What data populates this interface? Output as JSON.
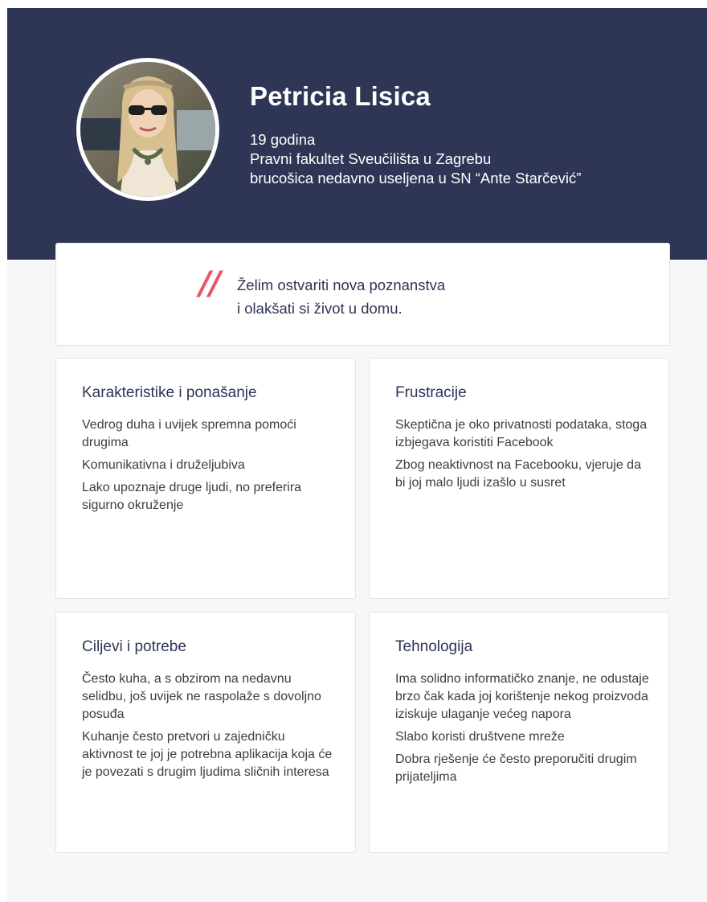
{
  "profile": {
    "name": "Petricia Lisica",
    "age": "19 godina",
    "faculty": "Pravni fakultet Sveučilišta u Zagrebu",
    "status": "brucošica nedavno useljena u SN “Ante Starčević”"
  },
  "quote": {
    "mark": "//",
    "line1": "Želim ostvariti nova poznanstva",
    "line2": "i olakšati si život u domu."
  },
  "cards": {
    "karakteristike": {
      "title": "Karakteristike i ponašanje",
      "items": [
        "Vedrog duha i uvijek spremna pomoći drugima",
        "Komunikativna i druželjubiva",
        "Lako upoznaje druge ljudi, no preferira sigurno okruženje"
      ]
    },
    "frustracije": {
      "title": "Frustracije",
      "items": [
        "Skeptična je oko privatnosti podataka, stoga izbjegava koristiti Facebook",
        "Zbog neaktivnost na Facebooku, vjeruje da bi joj malo ljudi izašlo u susret"
      ]
    },
    "ciljevi": {
      "title": "Ciljevi i potrebe",
      "items": [
        "Često kuha, a s obzirom na nedavnu selidbu, još uvijek ne raspolaže s dovoljno posuđa",
        "Kuhanje često pretvori u zajedničku aktivnost te joj je potrebna aplikacija koja će je povezati s drugim ljudima sličnih interesa"
      ]
    },
    "tehnologija": {
      "title": "Tehnologija",
      "items": [
        "Ima solidno informatičko znanje, ne odustaje brzo čak kada joj korištenje nekog proizvoda iziskuje ulaganje većeg napora",
        "Slabo koristi društvene mreže",
        "Dobra rješenje će često preporučiti drugim prijateljima"
      ]
    }
  },
  "colors": {
    "hero_background": "#2e3555",
    "page_background": "#f7f7f7",
    "quote_accent": "#e8566a",
    "heading_text": "#2e3555",
    "body_text": "#3d3d3d"
  }
}
